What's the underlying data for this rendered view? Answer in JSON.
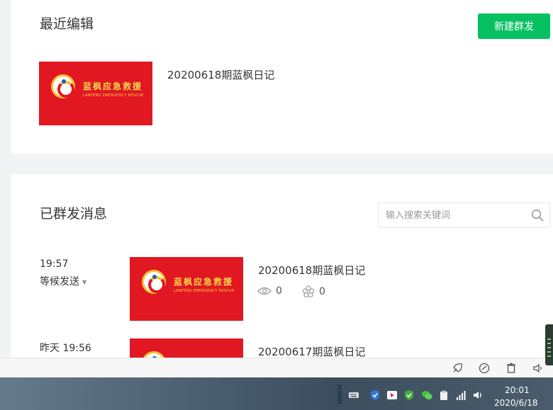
{
  "recent": {
    "section_title": "最近编辑",
    "new_button_label": "新建群发",
    "article": {
      "title": "20200618期蓝枫日记",
      "cover_text_cn": "蓝枫应急救援",
      "cover_text_en": "LANFENG EMERGENCY RESCUE"
    }
  },
  "sent": {
    "section_title": "已群发消息",
    "search_placeholder": "输入搜索关键词",
    "messages": [
      {
        "time": "19:57",
        "status": "等候发送",
        "title": "20200618期蓝枫日记",
        "reads": "0",
        "likes": "0",
        "cover_text_cn": "蓝枫应急救援",
        "cover_text_en": "LANFENG EMERGENCY RESCUE"
      },
      {
        "time": "昨天 19:56",
        "title": "20200617期蓝枫日记"
      }
    ]
  },
  "taskbar": {
    "time": "20:01",
    "date": "2020/6/18"
  },
  "colors": {
    "brand_green": "#07c160",
    "cover_red": "#e11721"
  }
}
